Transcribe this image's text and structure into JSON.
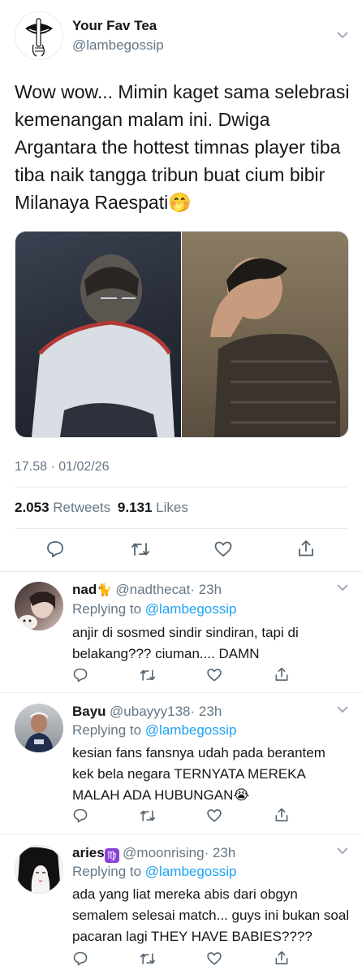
{
  "tweet": {
    "author_name": "Your Fav Tea",
    "author_handle": "@lambegossip",
    "text": "Wow wow... Mimin kaget sama selebrasi kemenangan malam ini. Dwiga Argantara the hottest timnas player tiba tiba naik tangga tribun buat cium bibir Milanaya Raespati",
    "text_emoji": "🤭",
    "timestamp": "17.58 · 01/02/26",
    "retweets_count": "2.053",
    "retweets_label": "Retweets",
    "likes_count": "9.131",
    "likes_label": "Likes"
  },
  "replies": [
    {
      "name": "nad",
      "name_emoji": "🐈",
      "handle": "@nadthecat",
      "time": "· 23h",
      "replying_label": "Replying to",
      "replying_handle": "@lambegossip",
      "text": "anjir di sosmed sindir sindiran, tapi di belakang??? ciuman.... DAMN",
      "text_emoji": ""
    },
    {
      "name": "Bayu",
      "name_emoji": "",
      "handle": "@ubayyy138",
      "time": "· 23h",
      "replying_label": "Replying to",
      "replying_handle": "@lambegossip",
      "text": "kesian fans fansnya udah pada berantem kek bela negara TERNYATA MEREKA MALAH ADA HUBUNGAN",
      "text_emoji": "😭"
    },
    {
      "name": "aries",
      "name_emoji": "♍",
      "handle": "@moonrising",
      "time": "· 23h",
      "replying_label": "Replying to",
      "replying_handle": "@lambegossip",
      "text": "ada yang liat mereka abis dari obgyn semalem selesai match... guys ini bukan soal pacaran lagi THEY HAVE BABIES????",
      "text_emoji": ""
    }
  ],
  "icons": {
    "reply": "reply-icon",
    "retweet": "retweet-icon",
    "like": "like-icon",
    "share": "share-icon",
    "more": "chevron-down-icon"
  },
  "colors": {
    "accent": "#1da1f2",
    "muted": "#657786",
    "divider": "#e6ecf0"
  }
}
